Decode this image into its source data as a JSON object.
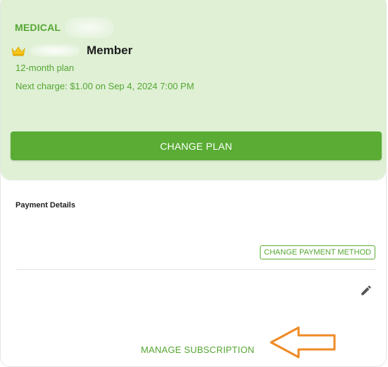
{
  "plan": {
    "category": "MEDICAL",
    "tier_label": "Member",
    "term": "12-month plan",
    "next_charge": "Next charge: $1.00 on Sep 4, 2024 7:00 PM",
    "change_plan_label": "CHANGE PLAN"
  },
  "payment": {
    "section_title": "Payment Details",
    "change_method_label": "CHANGE PAYMENT METHOD"
  },
  "subscription": {
    "manage_label": "MANAGE SUBSCRIPTION"
  },
  "icons": {
    "crown": "crown-icon",
    "edit": "pencil-icon",
    "annotation": "arrow-left-icon"
  },
  "colors": {
    "accent": "#5aac34",
    "panel": "#dff0d5",
    "annotation": "#f08a24"
  }
}
